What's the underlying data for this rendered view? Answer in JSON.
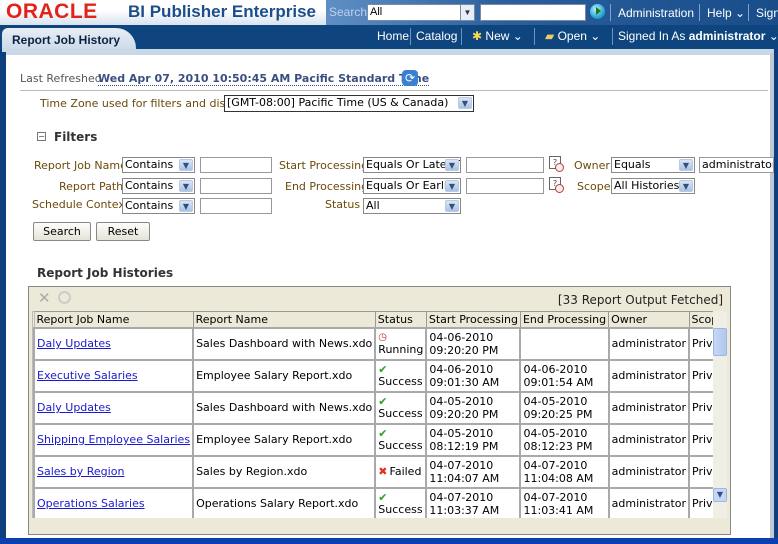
{
  "header": {
    "logo": "ORACLE",
    "product": "BI Publisher Enterprise",
    "search_label": "Search",
    "search_scope": "All",
    "search_placeholder": "",
    "links": [
      "Administration",
      "Help",
      "Sign Out"
    ]
  },
  "nav": {
    "active_tab": "Report Job History",
    "home": "Home",
    "catalog": "Catalog",
    "new": "New",
    "open": "Open",
    "signed_in_label": "Signed In As",
    "user": "administrator"
  },
  "page": {
    "last_refreshed_label": "Last Refreshed",
    "last_refreshed_value": "Wed Apr 07, 2010 10:50:45 AM Pacific Standard Time",
    "timezone_label": "Time Zone used for filters and display",
    "timezone_value": "[GMT-08:00] Pacific Time (US & Canada)",
    "filters_title": "Filters"
  },
  "filters": {
    "report_job_name": {
      "label": "Report Job Name",
      "op": "Contains",
      "value": ""
    },
    "report_path": {
      "label": "Report Path",
      "op": "Contains",
      "value": ""
    },
    "schedule_context": {
      "label": "Schedule Context",
      "op": "Contains",
      "value": ""
    },
    "start_processing": {
      "label": "Start Processing",
      "op": "Equals Or Later Than",
      "value": ""
    },
    "end_processing": {
      "label": "End Processing",
      "op": "Equals Or Earlier Than",
      "value": ""
    },
    "status": {
      "label": "Status",
      "value": "All"
    },
    "owner": {
      "label": "Owner",
      "op": "Equals",
      "value": "administrator"
    },
    "scope": {
      "label": "Scope",
      "value": "All Histories"
    },
    "search_button": "Search",
    "reset_button": "Reset"
  },
  "histories": {
    "title": "Report Job Histories",
    "fetched": "[33 Report Output Fetched]",
    "columns": [
      "Report Job Name",
      "Report Name",
      "Status",
      "Start Processing",
      "End Processing",
      "Owner",
      "Scope"
    ],
    "rows": [
      {
        "job": "Daly Updates",
        "report": "Sales Dashboard with News.xdo",
        "status": "Running",
        "start_date": "04-06-2010",
        "start_time": "09:20:20 PM",
        "end_date": "",
        "end_time": "",
        "owner": "administrator",
        "scope": "Private"
      },
      {
        "job": "Executive Salaries",
        "report": "Employee Salary Report.xdo",
        "status": "Success",
        "start_date": "04-06-2010",
        "start_time": "09:01:30 AM",
        "end_date": "04-06-2010",
        "end_time": "09:01:54 AM",
        "owner": "administrator",
        "scope": "Private"
      },
      {
        "job": "Daly Updates",
        "report": "Sales Dashboard with News.xdo",
        "status": "Success",
        "start_date": "04-05-2010",
        "start_time": "09:20:20 PM",
        "end_date": "04-05-2010",
        "end_time": "09:20:25 PM",
        "owner": "administrator",
        "scope": "Private"
      },
      {
        "job": "Shipping Employee Salaries",
        "report": "Employee Salary Report.xdo",
        "status": "Success",
        "start_date": "04-05-2010",
        "start_time": "08:12:19 PM",
        "end_date": "04-05-2010",
        "end_time": "08:12:23 PM",
        "owner": "administrator",
        "scope": "Private"
      },
      {
        "job": "Sales by Region",
        "report": "Sales by Region.xdo",
        "status": "Failed",
        "start_date": "04-07-2010",
        "start_time": "11:04:07 AM",
        "end_date": "04-07-2010",
        "end_time": "11:04:08 AM",
        "owner": "administrator",
        "scope": "Private"
      },
      {
        "job": "Operations Salaries",
        "report": "Operations Salary Report.xdo",
        "status": "Success",
        "start_date": "04-07-2010",
        "start_time": "11:03:37 AM",
        "end_date": "04-07-2010",
        "end_time": "11:03:41 AM",
        "owner": "administrator",
        "scope": "Private"
      }
    ]
  }
}
